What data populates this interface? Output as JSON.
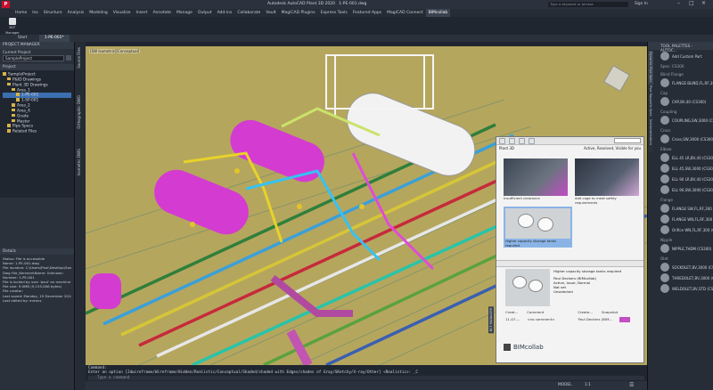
{
  "app": {
    "title": "Autodesk AutoCAD Plant 3D 2020",
    "file": "1-PE-001.dwg",
    "search_placeholder": "Type a keyword or phrase",
    "user": "Sign In"
  },
  "ribbon": {
    "tabs": [
      "Home",
      "Iso",
      "Structure",
      "Analysis",
      "Modeling",
      "Visualize",
      "Insert",
      "Annotate",
      "Manage",
      "Output",
      "Add-ins",
      "Collaborate",
      "Vault",
      "MagiCAD Plugins",
      "Express Tools",
      "Featured Apps",
      "MagiCAD Connect",
      "BIMcollab"
    ],
    "active": "BIMcollab"
  },
  "bcf": {
    "label": "BCF Manager",
    "group": "BIMcollab"
  },
  "doctabs": {
    "start": "Start",
    "file": "1-PE-001*"
  },
  "project_manager": {
    "title": "PROJECT MANAGER",
    "current_project_label": "Current Project",
    "current_project": "SampleProject",
    "project_label": "Project",
    "tree": [
      "SampleProject",
      "P&ID Drawings",
      "Plant 3D Drawings",
      "Area_1",
      "1-PE-001",
      "1-SP-001",
      "Area_2",
      "Area_A",
      "Grade",
      "Master",
      "Pipe Specs",
      "Related Files"
    ],
    "details_title": "Details",
    "details": [
      "Status: File is accessible",
      "Name: 1-PE-001.dwg",
      "File location: C:\\Users\\Paul\\Desktop\\SamplePr",
      "Dwg File_KenmerkName: Unknown",
      "Number: 1-PE-001",
      "File is locked by user 'paul' on machine 'MAC8",
      "File size: 9.0MB (9,155,006 bytes)",
      "File creator:",
      "Last saved: Monday, 19 December 2016 03:50",
      "Last edited by: mmerz"
    ]
  },
  "viewport": {
    "label": "[SW Isometric][Conceptual]",
    "vtabs": [
      "Source Files",
      "Orthographic DWG",
      "Isometric DWG"
    ]
  },
  "command": {
    "title": "Command:",
    "history": "Enter an option [2dwireframe/Wireframe/Hidden/Realistic/Conceptual/Shaded/shaded with Edges/shades of Gray/SKetchy/X-ray/Other] <Realistic>: _C",
    "placeholder": "Type a command"
  },
  "status_bar": {
    "model": "MODEL",
    "scale": "1:1"
  },
  "bimcollab": {
    "group": "Plant 3D",
    "filter_text": "Active, Resolved, Visible for you",
    "issues": [
      {
        "label": "Insufficient clearance"
      },
      {
        "label": "Add cage to meet safety requirements"
      },
      {
        "label": "Higher capacity storage tanks required"
      }
    ],
    "detail": {
      "title": "Higher capacity storage tanks required",
      "author": "Paul Deckers (BIMcollab)",
      "status": "Active, Issue, Normal",
      "assigned": "Not set",
      "milestone": "Unselected"
    },
    "comments_headers": [
      "Creat...",
      "Comment",
      "Create...",
      "Snapshot"
    ],
    "comment_row": {
      "date": "11-07-...",
      "text": "<no comment>",
      "author": "Paul Deckers (BIM..."
    },
    "footer": "BIMcollab",
    "side_label": "BCF MANAGER"
  },
  "tool_palette": {
    "title": "TOOL PALETTES - AUTOC...",
    "tabs": [
      "Dynamic Pipe Spec",
      "Pipe Supports Spec",
      "Instrumentation"
    ],
    "first_item": "Add Custom Part",
    "sections": [
      {
        "head": "Spec: CS300",
        "items": []
      },
      {
        "head": "Blind Flange",
        "items": [
          "FLANGE BLIND,FL,RF,300 (CS300)"
        ]
      },
      {
        "head": "Cap",
        "items": [
          "CAP,BV,40 (CS300)"
        ]
      },
      {
        "head": "Coupling",
        "items": [
          "COUPLING,SW,3000 (CS300)"
        ]
      },
      {
        "head": "Cross",
        "items": [
          "Cross,SW,3000 (CS300)"
        ]
      },
      {
        "head": "Elbow",
        "items": [
          "ELL 45 LR,BV,40 (CS300)",
          "ELL 45,SW,3000 (CS300)",
          "ELL 90 LR,BV,40 (CS300)",
          "ELL 90,SW,3000 (CS300)"
        ]
      },
      {
        "head": "Flange",
        "items": [
          "FLANGE SW,FL,RF,300 (CS300)",
          "FLANGE WN,FL,RF,300 (CS300)",
          "Orifice WN,FL,RF,300 (CS300)"
        ]
      },
      {
        "head": "Nipple",
        "items": [
          "NIPPLE,THDM (CS300)"
        ]
      },
      {
        "head": "Olet",
        "items": [
          "SOCKOLET,BV,3000 (CS300)",
          "THREDOLET,BV,3000 (CS300)",
          "WELDOLET,BV,STD (CS300)"
        ]
      }
    ]
  }
}
